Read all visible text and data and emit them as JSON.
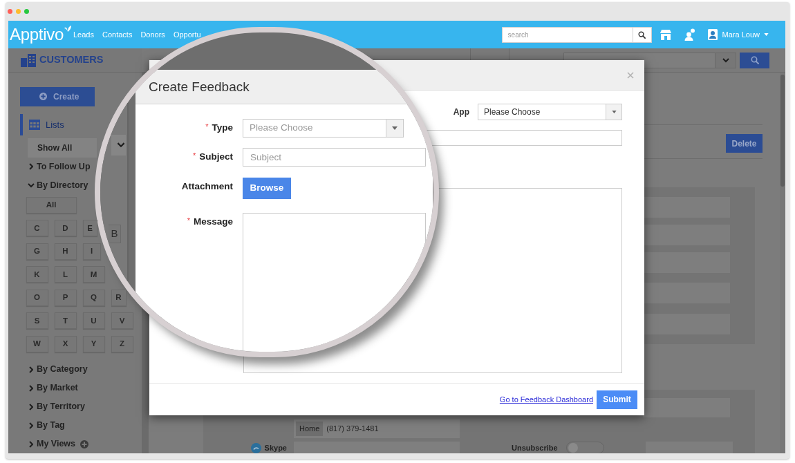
{
  "window": {
    "controls": [
      {
        "color": "#ff5f57"
      },
      {
        "color": "#febc2e"
      },
      {
        "color": "#28c840"
      }
    ]
  },
  "navbar": {
    "logo": "Apptivo",
    "links": [
      "Leads",
      "Contacts",
      "Donors",
      "Opportu"
    ],
    "search": {
      "placeholder": "search"
    },
    "user": "Mara Louw"
  },
  "page_header": {
    "title": "CUSTOMERS"
  },
  "sidebar": {
    "create": "Create",
    "lists": {
      "label": "Lists",
      "selected": true
    },
    "show_all": "Show All",
    "items": [
      {
        "label": "To Follow Up",
        "expanded": false,
        "add_button": false
      },
      {
        "label": "By Directory",
        "expanded": true,
        "add_button": false,
        "all": "All",
        "letter_rows": [
          [
            "C",
            "D",
            "E"
          ],
          [
            "G",
            "H",
            "I"
          ],
          [
            "K",
            "L",
            "M"
          ],
          [
            "O",
            "P",
            "Q",
            "R"
          ],
          [
            "S",
            "T",
            "U",
            "V"
          ],
          [
            "W",
            "X",
            "Y",
            "Z"
          ]
        ]
      },
      {
        "label": "By Category",
        "expanded": false,
        "add_button": false
      },
      {
        "label": "By Market",
        "expanded": false,
        "add_button": false
      },
      {
        "label": "By Territory",
        "expanded": false,
        "add_button": false
      },
      {
        "label": "By Tag",
        "expanded": false,
        "add_button": false
      },
      {
        "label": "My Views",
        "expanded": false,
        "add_button": true
      }
    ]
  },
  "content": {
    "delete": "Delete",
    "phone": {
      "tag": "Home",
      "value": "(817) 379-1481"
    },
    "skype": {
      "label": "Skype"
    },
    "unsubscribe": {
      "label": "Unsubscribe",
      "on": false
    }
  },
  "dialog": {
    "app": {
      "label": "App",
      "value": "Please Choose"
    },
    "link": "Go to Feedback Dashboard",
    "submit": "Submit"
  },
  "magnifier": {
    "sidebar_letter": "B",
    "dialog": {
      "title": "Create Feedback",
      "fields": [
        {
          "kind": "select",
          "label": "Type",
          "required_mark": "*",
          "placeholder": "Please Choose"
        },
        {
          "kind": "input",
          "label": "Subject",
          "required_mark": "*",
          "placeholder": "Subject"
        },
        {
          "kind": "file",
          "label": "Attachment",
          "button": "Browse"
        },
        {
          "kind": "textarea",
          "label": "Message",
          "required_mark": "*"
        }
      ]
    }
  }
}
